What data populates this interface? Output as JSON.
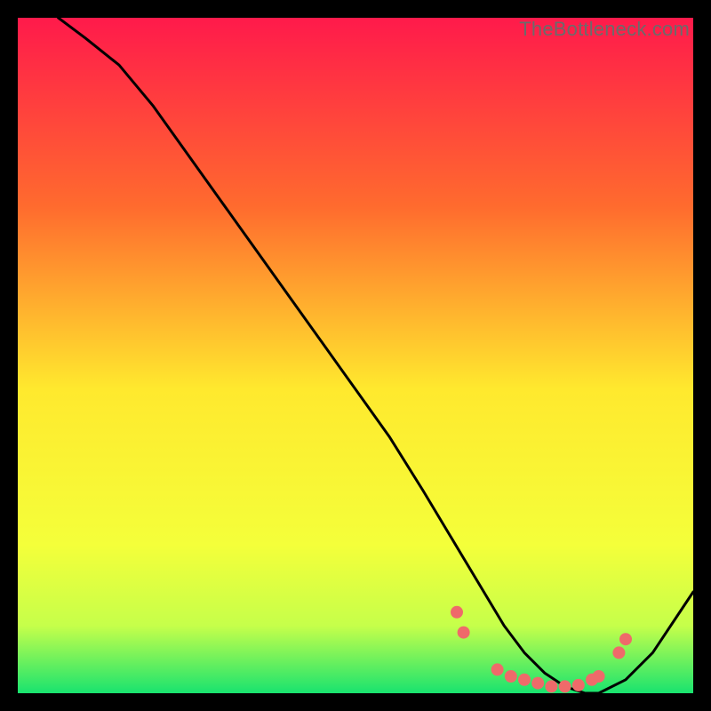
{
  "watermark": "TheBottleneck.com",
  "chart_data": {
    "type": "line",
    "title": "",
    "xlabel": "",
    "ylabel": "",
    "xlim": [
      0,
      100
    ],
    "ylim": [
      0,
      100
    ],
    "grid": false,
    "background_gradient": {
      "top_color": "#ff1a4b",
      "upper_mid_color": "#ff8a2a",
      "mid_color": "#ffe92e",
      "lower_mid_color": "#eaff4a",
      "bottom_color": "#19e36f"
    },
    "series": [
      {
        "name": "bottleneck-curve",
        "color": "#000000",
        "x": [
          6,
          10,
          15,
          20,
          25,
          30,
          35,
          40,
          45,
          50,
          55,
          60,
          63,
          66,
          69,
          72,
          75,
          78,
          81,
          84,
          86,
          90,
          94,
          100
        ],
        "y": [
          100,
          97,
          93,
          87,
          80,
          73,
          66,
          59,
          52,
          45,
          38,
          30,
          25,
          20,
          15,
          10,
          6,
          3,
          1,
          0,
          0,
          2,
          6,
          15
        ]
      }
    ],
    "markers": {
      "name": "highlight-dots",
      "color": "#ef6a6a",
      "radius": 7,
      "points": [
        {
          "x": 65,
          "y": 12
        },
        {
          "x": 66,
          "y": 9
        },
        {
          "x": 71,
          "y": 3.5
        },
        {
          "x": 73,
          "y": 2.5
        },
        {
          "x": 75,
          "y": 2
        },
        {
          "x": 77,
          "y": 1.5
        },
        {
          "x": 79,
          "y": 1
        },
        {
          "x": 81,
          "y": 1
        },
        {
          "x": 83,
          "y": 1.2
        },
        {
          "x": 85,
          "y": 2
        },
        {
          "x": 86,
          "y": 2.5
        },
        {
          "x": 89,
          "y": 6
        },
        {
          "x": 90,
          "y": 8
        }
      ]
    }
  }
}
